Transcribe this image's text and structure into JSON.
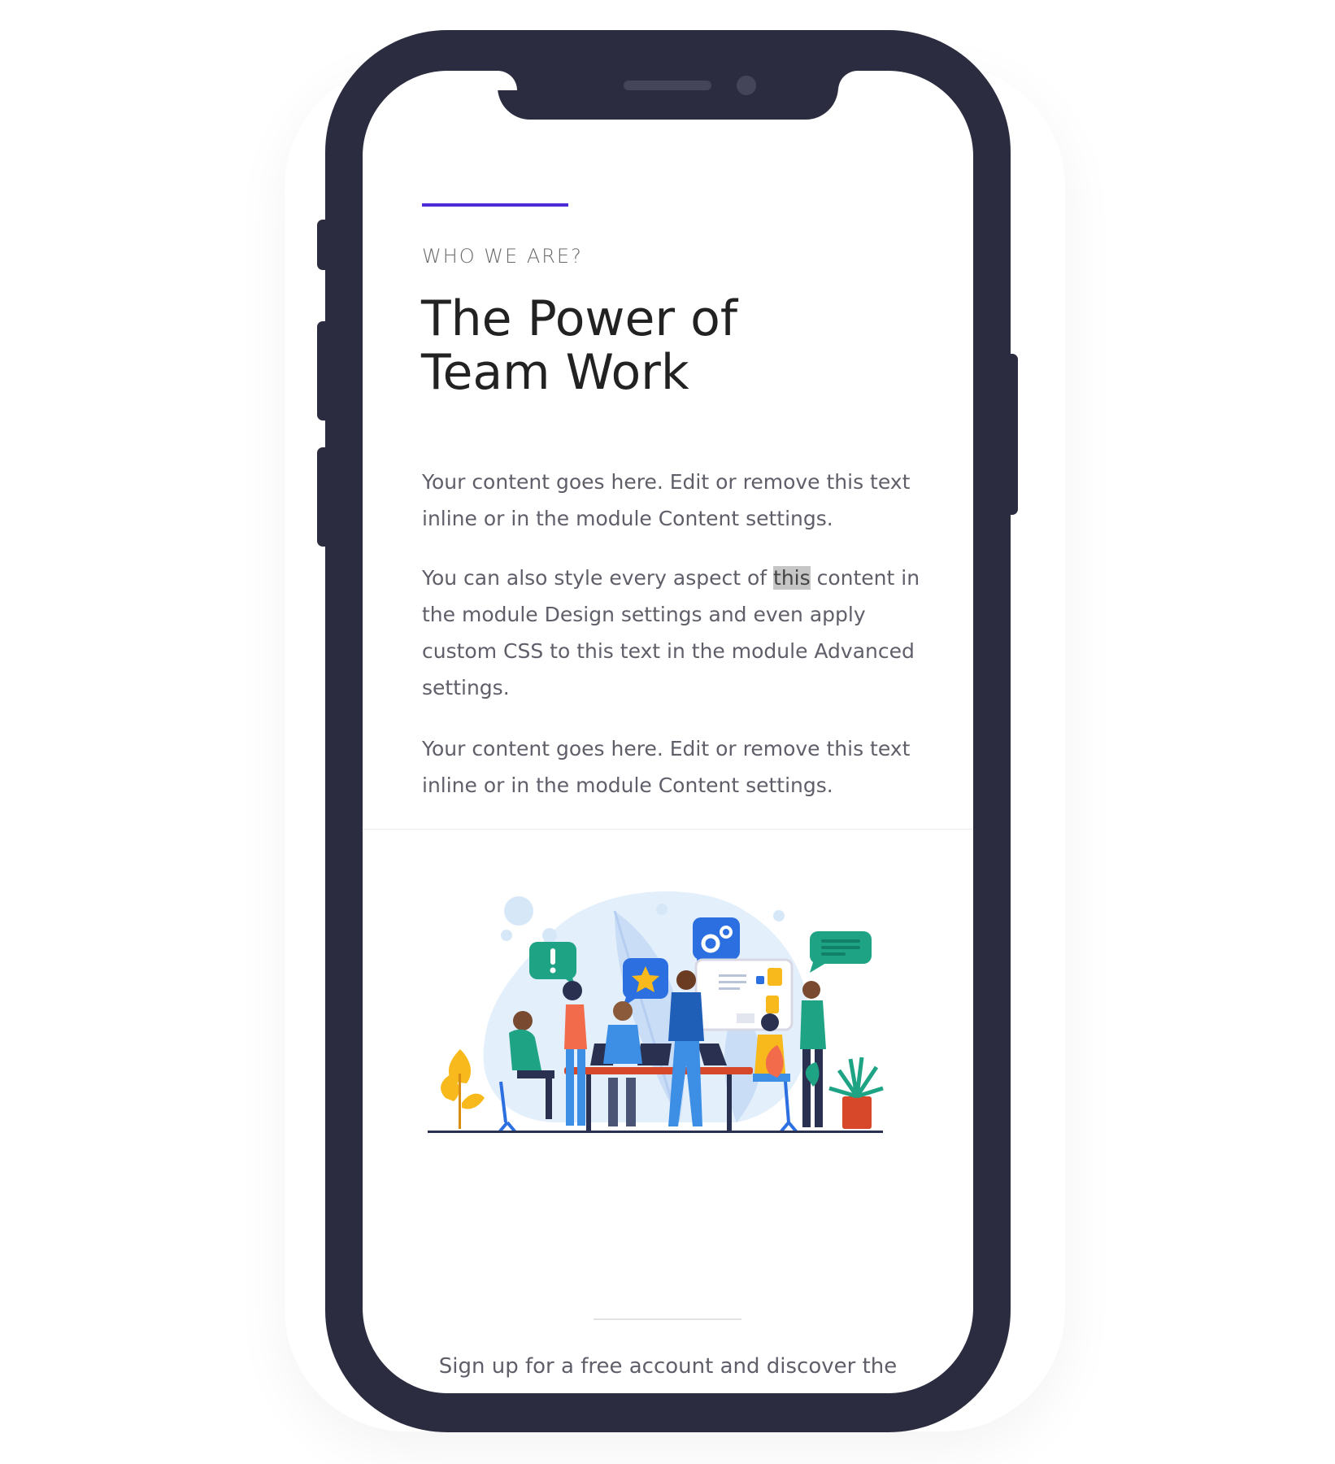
{
  "section": {
    "eyebrow": "WHO WE ARE?",
    "headline_line1": "The Power of",
    "headline_line2": "Team Work",
    "paragraph1": "Your content goes here. Edit or remove this text inline or in the module Content settings.",
    "paragraph2_before": "You can also style every aspect of ",
    "paragraph2_highlight": "this",
    "paragraph2_after": " content in the module Design settings and even apply custom CSS to this text in the module Advanced settings.",
    "paragraph3": "Your content goes here. Edit or remove this text inline or in the module Content settings."
  },
  "footer": {
    "signup_text": "Sign up for a free account and discover the"
  },
  "colors": {
    "phone_frame": "#2c2c40",
    "accent": "#4a2bd6",
    "body_text": "#5f5f6a",
    "headline": "#222222"
  },
  "illustration": {
    "icons": [
      "alert-bubble-icon",
      "star-bubble-icon",
      "gear-bubble-icon",
      "chat-bubble-icon"
    ]
  }
}
